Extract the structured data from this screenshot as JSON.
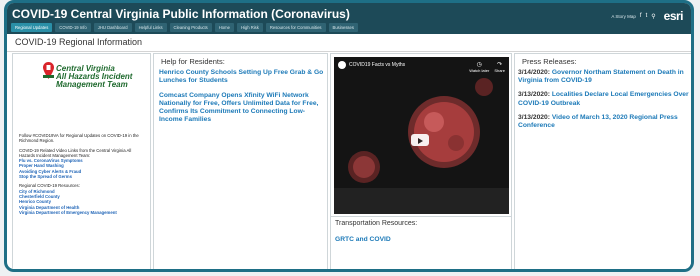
{
  "app": {
    "title": "COVID-19 Central Virginia Public Information (Coronavirus)",
    "tabs": [
      "Regional Updates",
      "COVID-19 Info",
      "JHU Dashboard",
      "Helpful Links",
      "Cleaning Products",
      "Home",
      "High Risk",
      "Resources for Communities",
      "Businesses"
    ],
    "story_map_label": "A Story Map",
    "brand": "esri"
  },
  "page": {
    "title": "COVID-19 Regional Information"
  },
  "logo": {
    "line1": "Central Virginia",
    "line2": "All Hazards Incident",
    "line3": "Management Team"
  },
  "left_panel": {
    "follow_text": "Follow #COVID19VA for Regional Updates on COVID-19 in the Richmond Region.",
    "video_links_intro": "COVID-19 Related Video Links from the Central Virginia All Hazards Incident Management Team:",
    "video_links": [
      "Flu vs. CoronaVirus Symptoms",
      "Proper Hand Washing",
      "Avoiding Cyber Alerts & Fraud",
      "Stop the Spread of Germs"
    ],
    "resources_intro": "Regional COVID-19 Resources:",
    "resources": [
      "City of Richmond",
      "Chesterfield County",
      "Henrico County",
      "Virginia Department of Health",
      "Virginia Department of Emergency Management"
    ]
  },
  "residents": {
    "header": "Help for Residents:",
    "items": [
      "Henrico County Schools Setting Up Free Grab & Go Lunches for Students",
      "Comcast Company Opens Xfinity WiFi Network Nationally for Free, Offers Unlimited Data for Free, Confirms Its Commitment to Connecting Low-Income Families"
    ]
  },
  "video": {
    "title": "COVID19 Facts vs Myths",
    "watch_later": "Watch later",
    "share": "Share"
  },
  "transportation": {
    "header": "Transportation Resources:",
    "link": "GRTC and COVID"
  },
  "press": {
    "header": "Press Releases:",
    "items": [
      {
        "date": "3/14/2020:",
        "text": "Governor Northam Statement on Death in Virginia from COVID-19"
      },
      {
        "date": "3/13/2020:",
        "text": "Localities Declare Local Emergencies Over COVID-19 Outbreak"
      },
      {
        "date": "3/13/2020:",
        "text": "Video of March 13, 2020 Regional Press Conference"
      }
    ]
  }
}
